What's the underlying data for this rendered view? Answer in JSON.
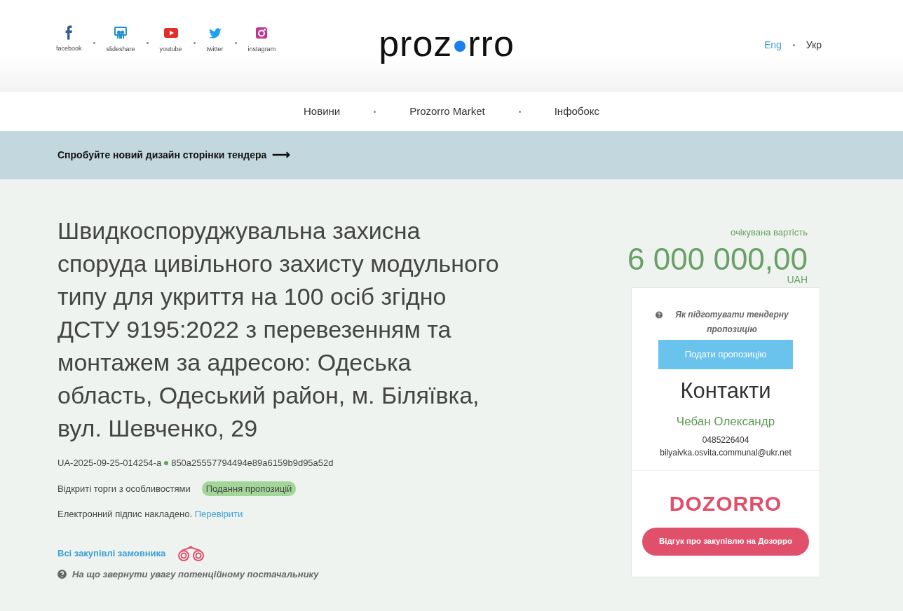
{
  "social": [
    {
      "kind": "facebook",
      "label": "facebook"
    },
    {
      "kind": "slideshare",
      "label": "slideshare"
    },
    {
      "kind": "youtube",
      "label": "youtube"
    },
    {
      "kind": "twitter",
      "label": "twitter"
    },
    {
      "kind": "instagram",
      "label": "instagram"
    }
  ],
  "logo": {
    "left": "proz",
    "right": "rro"
  },
  "languages": [
    {
      "label": "Eng",
      "selected": false
    },
    {
      "label": "Укр",
      "selected": true
    }
  ],
  "nav": [
    "Новини",
    "Prozorro Market",
    "Інфобокс"
  ],
  "banner": {
    "text": "Спробуйте новий дизайн сторінки тендера",
    "arrow": "⟶"
  },
  "tender": {
    "title": "Швидкоспоруджувальна захисна споруда цивільного захисту модульного типу для укриття на 100 осіб згідно ДСТУ 9195:2022 з перевезенням та монтажем за адресою: Одеська область, Одеський район, м. Біляївка, вул. Шевченко, 29",
    "id": "UA-2025-09-25-014254-a",
    "hash": "850a25557794494e89a6159b9d95a52d",
    "procedure": "Відкриті торги з особливостями",
    "status": "Подання пропозицій",
    "signature": "Електронний підпис накладено.",
    "verify_link": "Перевірити",
    "all_purchases": "Всі закупівлі замовника",
    "hint": "На що звернути увагу потенційному постачальнику"
  },
  "price": {
    "label": "очікувана вартість",
    "amount": "6 000 000,00",
    "currency": "UAH"
  },
  "sidebar": {
    "help": "Як підготувати тендерну пропозицію",
    "submit": "Подати пропозицію",
    "contacts_title": "Контакти",
    "contact_name": "Чебан Олександр",
    "phone": "0485226404",
    "email": "bilyaivka.osvita.communal@ukr.net",
    "dozorro_logo": "DOZORRO",
    "dozorro_button": "Відгук про закупівлю на Дозорро"
  }
}
